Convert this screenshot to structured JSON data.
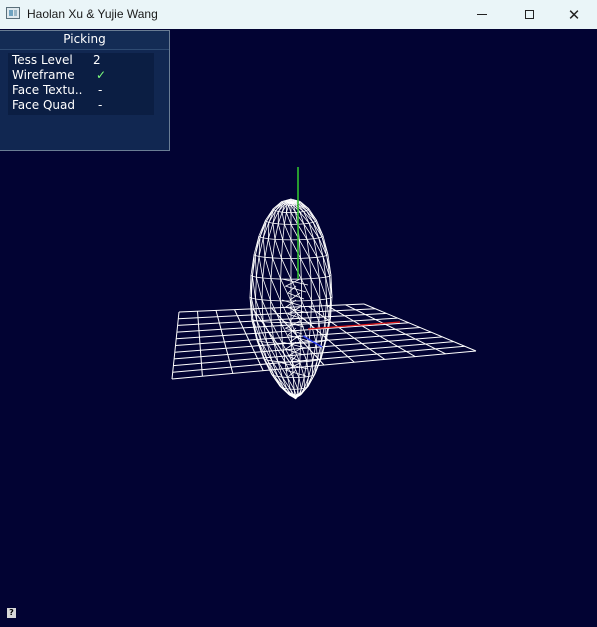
{
  "window": {
    "title": "Haolan Xu & Yujie Wang",
    "close_glyph": "✕"
  },
  "panel": {
    "title": "Picking",
    "rows": [
      {
        "label": "Tess Level",
        "value": "2"
      },
      {
        "label": "Wireframe",
        "value": "✓"
      },
      {
        "label": "Face Textu..",
        "value": "-"
      },
      {
        "label": "Face Quad",
        "value": "-"
      }
    ]
  },
  "help": {
    "glyph": "?"
  },
  "scene": {
    "background": "#020333",
    "grid_color": "#ffffff",
    "mesh_color": "#ffffff",
    "axis_y_color": "#2fc02f",
    "axis_x_color": "#e01818",
    "axis_z_color": "#2a3cf0"
  }
}
